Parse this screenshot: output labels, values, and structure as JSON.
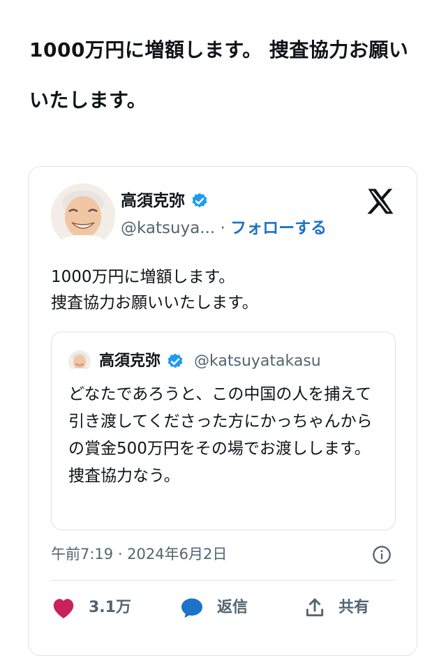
{
  "article": {
    "headline": "1000万円に増額します。 捜査協力お願いいたします。"
  },
  "embed": {
    "author": {
      "name": "高須克弥",
      "handle": "@katsuya...",
      "separator": "·",
      "follow_label": "フォローする",
      "verified_icon": "verified-badge-icon"
    },
    "brand_icon": "x-logo-icon",
    "text": "1000万円に増額します。\n捜査協力お願いいたします。",
    "quote": {
      "author_name": "高須克弥",
      "author_handle": "@katsuyatakasu",
      "text": "どなたであろうと、この中国の人を捕えて引き渡してくださった方にかっちゃんからの賞金500万円をその場でお渡しします。\n捜査協力なう。"
    },
    "timestamp": "午前7:19 · 2024年6月2日",
    "actions": {
      "like_count": "3.1万",
      "reply_label": "返信",
      "share_label": "共有"
    },
    "colors": {
      "verified": "#1d9bf0",
      "follow": "#1d72c9",
      "like": "#c8215d",
      "reply": "#1d72c9"
    }
  }
}
